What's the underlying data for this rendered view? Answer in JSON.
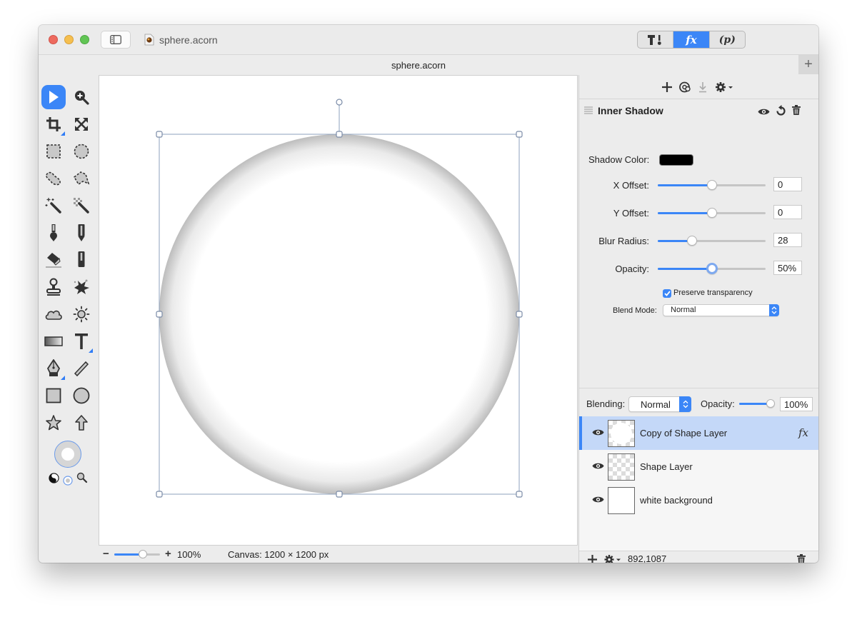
{
  "window": {
    "title": "sphere.acorn",
    "tab_title": "sphere.acorn",
    "new_tab_label": "+"
  },
  "toolbar_segments": [
    {
      "name": "tools-palette",
      "icon": "hammer-brush-icon",
      "active": false
    },
    {
      "name": "effects",
      "label": "fx",
      "active": true
    },
    {
      "name": "properties",
      "label": "(p)",
      "active": false
    }
  ],
  "tools": {
    "selected": "select-tool",
    "items": [
      "select",
      "zoom",
      "crop",
      "transform",
      "rect-select",
      "ellipse-select",
      "lasso",
      "polygon-lasso",
      "magic-wand",
      "instant-alpha",
      "brush",
      "pencil",
      "eraser",
      "clone-bar",
      "stamp",
      "burn",
      "cloud",
      "brightness",
      "gradient",
      "text",
      "pen",
      "line",
      "rectangle",
      "ellipse",
      "star",
      "arrow"
    ]
  },
  "canvas": {
    "zoom_label": "100%",
    "zoom_fraction": 0.5,
    "size_label": "Canvas: 1200 × 1200 px"
  },
  "filter": {
    "name": "Inner Shadow",
    "shadow_color_label": "Shadow Color:",
    "shadow_color": "#000000",
    "x_offset_label": "X Offset:",
    "x_offset": "0",
    "x_offset_fraction": 0.5,
    "y_offset_label": "Y Offset:",
    "y_offset": "0",
    "y_offset_fraction": 0.5,
    "blur_label": "Blur Radius:",
    "blur": "28",
    "blur_fraction": 0.3,
    "opacity_label": "Opacity:",
    "opacity": "50%",
    "opacity_fraction": 0.5,
    "preserve_label": "Preserve transparency",
    "preserve_checked": true,
    "blend_mode_label": "Blend Mode:",
    "blend_mode": "Normal"
  },
  "layer_controls": {
    "blending_label": "Blending:",
    "blending": "Normal",
    "opacity_label": "Opacity:",
    "opacity": "100%",
    "opacity_fraction": 1.0
  },
  "layers": [
    {
      "name": "Copy of Shape Layer",
      "visible": true,
      "selected": true,
      "has_fx": true,
      "fx_label": "fx"
    },
    {
      "name": "Shape Layer",
      "visible": true,
      "selected": false,
      "has_fx": false
    },
    {
      "name": "white background",
      "visible": true,
      "selected": false,
      "has_fx": false
    }
  ],
  "footer": {
    "coords": "892,1087"
  },
  "colors": {
    "accent": "#3b86f7",
    "selection_row": "#c4d8f8"
  }
}
